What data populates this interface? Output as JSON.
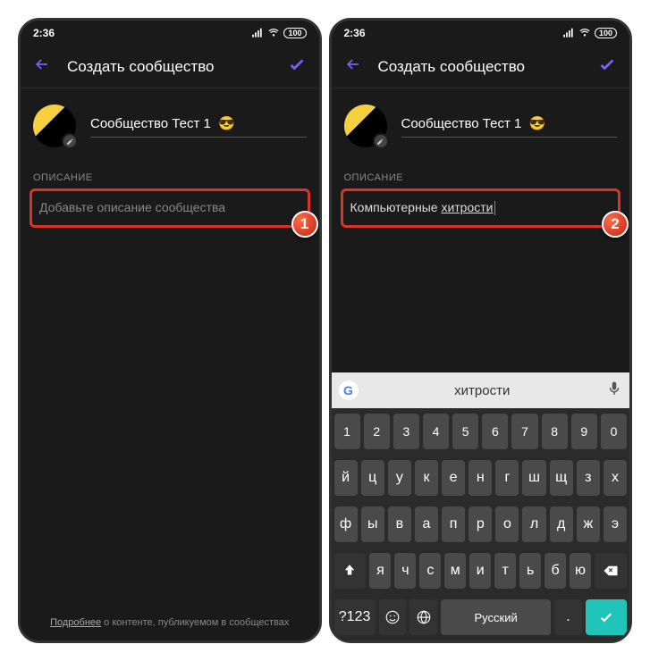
{
  "status": {
    "time": "2:36",
    "battery": "100"
  },
  "header": {
    "title": "Создать сообщество"
  },
  "community": {
    "name": "Сообщество Тест 1",
    "emoji": "😎"
  },
  "section": {
    "description_label": "ОПИСАНИЕ",
    "placeholder": "Добавьте описание сообщества",
    "entered_prefix": "Компьютерные ",
    "entered_underline": "хитрости"
  },
  "badges": {
    "step1": "1",
    "step2": "2"
  },
  "footer": {
    "link_text": "Подробнее",
    "rest": " о контенте, публикуемом в сообществах"
  },
  "keyboard": {
    "suggestion": "хитрости",
    "rows": {
      "nums": [
        "1",
        "2",
        "3",
        "4",
        "5",
        "6",
        "7",
        "8",
        "9",
        "0"
      ],
      "r1": [
        "й",
        "ц",
        "у",
        "к",
        "е",
        "н",
        "г",
        "ш",
        "щ",
        "з",
        "х"
      ],
      "r2": [
        "ф",
        "ы",
        "в",
        "а",
        "п",
        "р",
        "о",
        "л",
        "д",
        "ж",
        "э"
      ],
      "r3_mid": [
        "я",
        "ч",
        "с",
        "м",
        "и",
        "т",
        "ь",
        "б",
        "ю"
      ],
      "bottom": {
        "sym": "?123",
        "space": "Русский",
        "dot": "."
      }
    }
  }
}
